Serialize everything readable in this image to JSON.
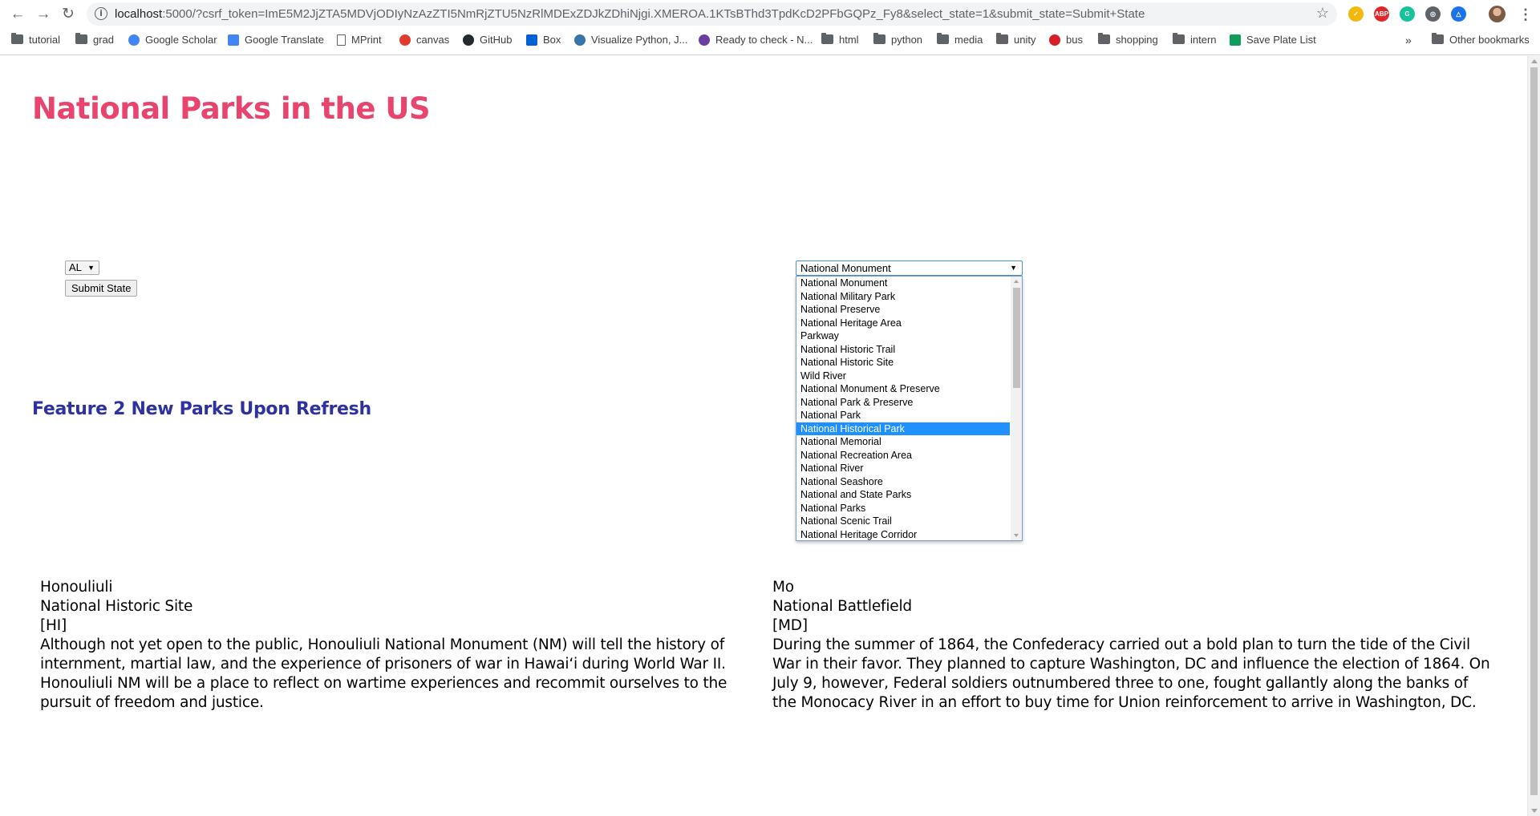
{
  "browser": {
    "url_host": "localhost",
    "url_rest": ":5000/?csrf_token=ImE5M2JjZTA5MDVjODIyNzAzZTI5NmRjZTU5NzRlMDExZDJkZDhiNjgi.XMEROA.1KTsBThd3TpdKcD2PFbGQPz_Fy8&select_state=1&submit_state=Submit+State",
    "icons": {
      "back": "back-arrow-icon",
      "forward": "forward-arrow-icon",
      "reload": "reload-icon",
      "star": "bookmark-star-icon"
    },
    "extensions": [
      {
        "name": "norton-icon",
        "color": "#f2b90c",
        "label": "✓"
      },
      {
        "name": "adblock-icon",
        "color": "#e0262b",
        "label": "ABP"
      },
      {
        "name": "grammarly-icon",
        "color": "#15c39a",
        "label": "G"
      },
      {
        "name": "extension-icon",
        "color": "#5f6368",
        "label": "◎"
      },
      {
        "name": "drive-icon",
        "color": "#1a73e8",
        "label": "△"
      }
    ],
    "menu_glyph": "⋮",
    "bookmarks": [
      {
        "label": "tutorial",
        "icon": "folder"
      },
      {
        "label": "grad",
        "icon": "folder"
      },
      {
        "label": "Google Scholar",
        "icon": "round",
        "color": "#4285f4"
      },
      {
        "label": "Google Translate",
        "icon": "sq",
        "color": "#4285f4"
      },
      {
        "label": "MPrint",
        "icon": "page"
      },
      {
        "label": "canvas",
        "icon": "round",
        "color": "#e23b2e"
      },
      {
        "label": "GitHub",
        "icon": "round",
        "color": "#24292e"
      },
      {
        "label": "Box",
        "icon": "sq",
        "color": "#0061d5"
      },
      {
        "label": "Visualize Python, J...",
        "icon": "round",
        "color": "#3776ab"
      },
      {
        "label": "Ready to check - N...",
        "icon": "round",
        "color": "#6b3fa0"
      },
      {
        "label": "html",
        "icon": "folder"
      },
      {
        "label": "python",
        "icon": "folder"
      },
      {
        "label": "media",
        "icon": "folder"
      },
      {
        "label": "unity",
        "icon": "folder"
      },
      {
        "label": "bus",
        "icon": "round",
        "color": "#d61f26"
      },
      {
        "label": "shopping",
        "icon": "folder"
      },
      {
        "label": "intern",
        "icon": "folder"
      },
      {
        "label": "Save Plate List",
        "icon": "sq",
        "color": "#0f9d58"
      }
    ],
    "bookmarks_more": "»",
    "other_bookmarks": "Other bookmarks"
  },
  "page": {
    "title": "National Parks in the US",
    "state_select": {
      "value": "AL",
      "arrow": "▼"
    },
    "submit_label": "Submit State",
    "type_select": {
      "value": "National Monument",
      "arrow": "▼",
      "options": [
        "National Monument",
        "National Military Park",
        "National Preserve",
        "National Heritage Area",
        "Parkway",
        "National Historic Trail",
        "National Historic Site",
        "Wild River",
        "National Monument & Preserve",
        "National Park & Preserve",
        "National Park",
        "National Historical Park",
        "National Memorial",
        "National Recreation Area",
        "National River",
        "National Seashore",
        "National and State Parks",
        "National Parks",
        "National Scenic Trail",
        "National Heritage Corridor"
      ],
      "highlighted": "National Historical Park"
    },
    "feature_heading": "Feature 2 New Parks Upon Refresh",
    "parks": [
      {
        "name": "Honouliuli",
        "type": "National Historic Site",
        "state": "[HI]",
        "description": "Although not yet open to the public, Honouliuli National Monument (NM) will tell the history of internment, martial law, and the experience of prisoners of war in Hawaiʻi during World War II. Honouliuli NM will be a place to reflect on wartime experiences and recommit ourselves to the pursuit of freedom and justice."
      },
      {
        "name": "Mo",
        "type": "National Battlefield",
        "state": "[MD]",
        "description": "During the summer of 1864, the Confederacy carried out a bold plan to turn the tide of the Civil War in their favor.  They planned to capture Washington, DC and influence the election of 1864.  On July 9, however, Federal soldiers outnumbered three to one, fought gallantly along the banks of the Monocacy River in an effort to buy time for Union reinforcement to arrive in Washington, DC."
      }
    ]
  },
  "colors": {
    "title": "#e8446d",
    "feature_heading": "#2e32a0",
    "highlight": "#1e90ff"
  }
}
